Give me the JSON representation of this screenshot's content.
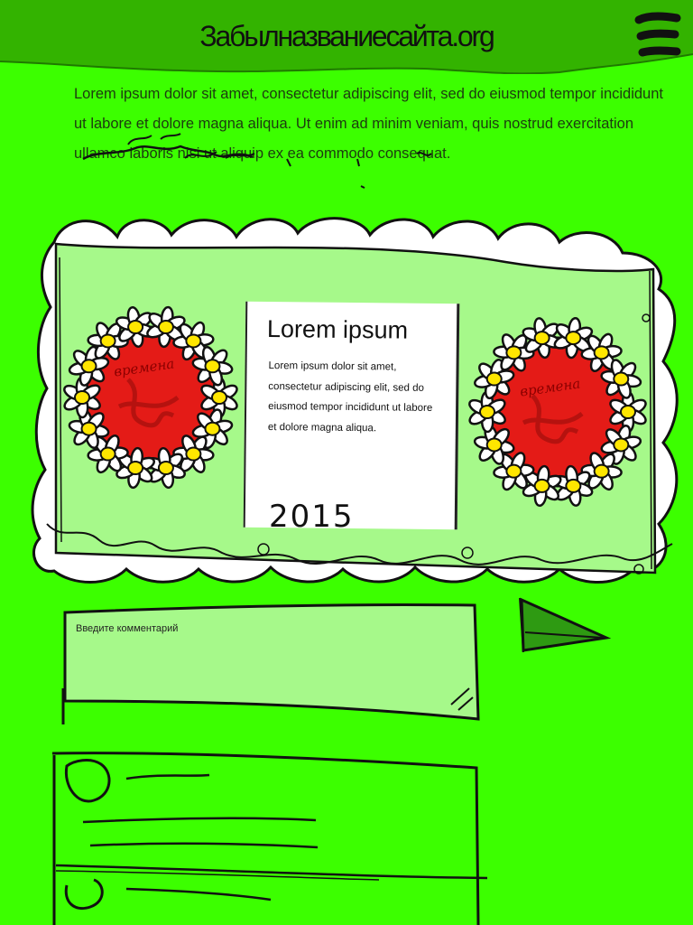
{
  "header": {
    "site_title": "Забылназваниесайта.org",
    "menu_icon": "hamburger-menu-icon"
  },
  "intro": {
    "text": "Lorem ipsum dolor sit amet, consectetur adipiscing elit, sed do eiusmod tempor incididunt ut labore et dolore magna aliqua. Ut enim ad minim veniam, quis nostrud exercitation ullamco laboris nisi ut aliquip ex ea commodo consequat."
  },
  "slider": {
    "left_badge_label": "времена",
    "right_badge_label": "времена",
    "card": {
      "title": "Lorem ipsum",
      "text": "Lorem ipsum dolor sit amet, consectetur adipiscing elit, sed do eiusmod tempor incididunt ut labore et dolore magna aliqua."
    },
    "year": "2015"
  },
  "comment_form": {
    "placeholder": "Введите комментарий",
    "send_icon": "send-arrow-icon"
  },
  "comments": {
    "items": [
      {
        "avatar": "avatar-circle-icon"
      },
      {
        "avatar": "avatar-circle-icon"
      }
    ]
  },
  "colors": {
    "background": "#3cff00",
    "header": "#33b300",
    "panel": "#a6f98a",
    "badge_red": "#e41b17",
    "send_green": "#2e9a12"
  }
}
